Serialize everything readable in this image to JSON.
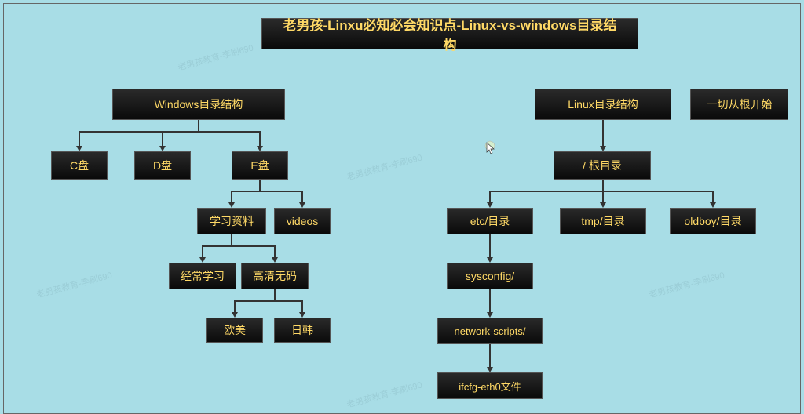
{
  "title": "老男孩-Linxu必知必会知识点-Linux-vs-windows目录结构",
  "windows": {
    "root": "Windows目录结构",
    "drives": {
      "c": "C盘",
      "d": "D盘",
      "e": "E盘"
    },
    "e_children": {
      "study": "学习资料",
      "videos": "videos"
    },
    "study_children": {
      "often": "经常学习",
      "hd": "高清无码"
    },
    "hd_children": {
      "western": "欧美",
      "jk": "日韩"
    }
  },
  "linux": {
    "root": "Linux目录结构",
    "aside": "一切从根开始",
    "rootdir": "/ 根目录",
    "children": {
      "etc": "etc/目录",
      "tmp": "tmp/目录",
      "oldboy": "oldboy/目录"
    },
    "etc_child": "sysconfig/",
    "sysconfig_child": "network-scripts/",
    "ns_child": "ifcfg-eth0文件"
  }
}
